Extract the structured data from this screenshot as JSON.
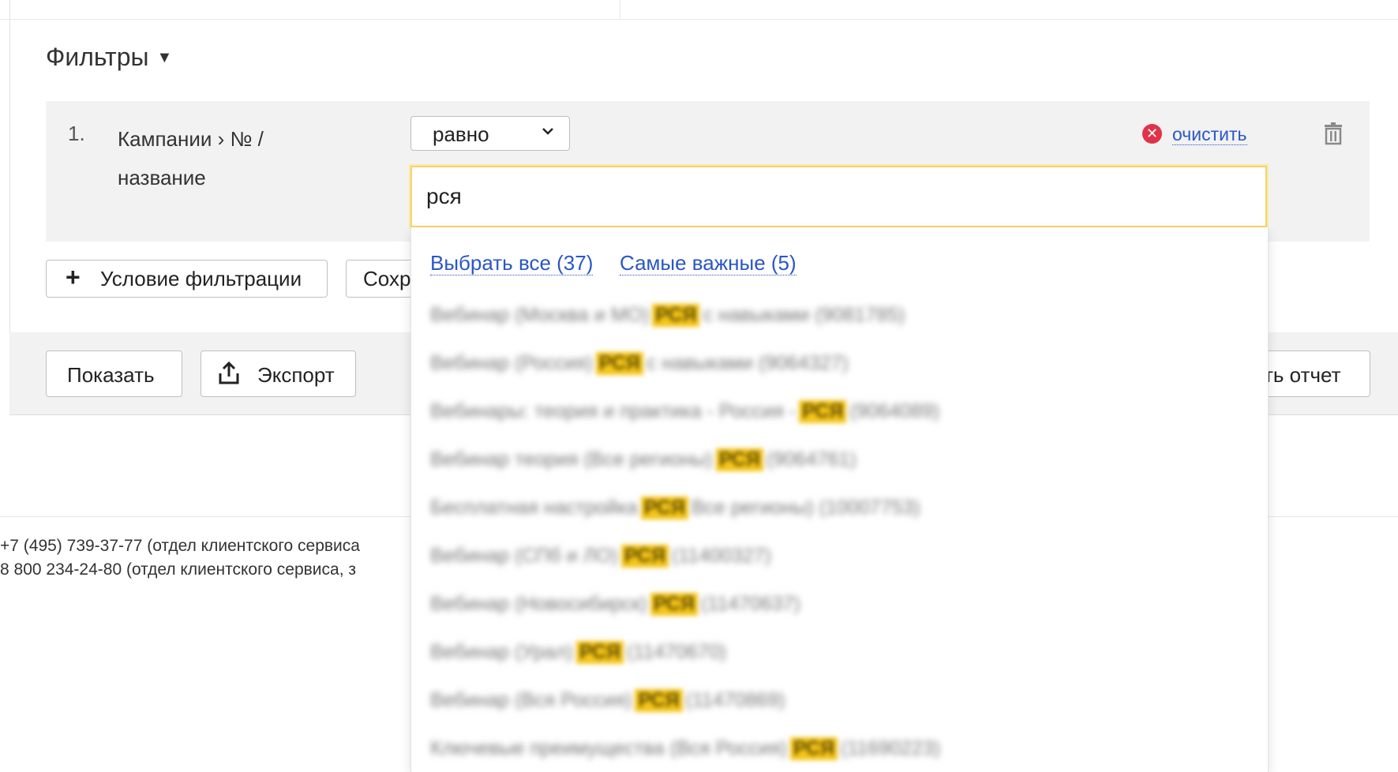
{
  "filters": {
    "title": "Фильтры",
    "toggle_arrow": "▼",
    "row": {
      "index": "1.",
      "field_line1": "Кампании › № /",
      "field_line2": "название",
      "operator": "равно",
      "clear_label": "очистить",
      "search_value": "рся"
    },
    "add_condition_label": "Условие фильтрации",
    "save_label_visible": "Сохр"
  },
  "dropdown": {
    "select_all": "Выбрать все  (37)",
    "most_important": "Самые важные  (5)",
    "items": [
      {
        "before": "Вебинар (Москва и МО)",
        "match": "РСЯ",
        "after": "с навыками (9081785)"
      },
      {
        "before": "Вебинар (Россия)",
        "match": "РСЯ",
        "after": "с навыками (9064327)"
      },
      {
        "before": "Вебинары: теория и практика - Россия -",
        "match": "РСЯ",
        "after": "(9064089)"
      },
      {
        "before": "Вебинар теория (Все регионы)",
        "match": "РСЯ",
        "after": "(9064761)"
      },
      {
        "before": "Бесплатная настройка",
        "match": "РСЯ",
        "after": "Все регионы) (10007753)"
      },
      {
        "before": "Вебинар (СПб и ЛО)",
        "match": "РСЯ",
        "after": "(11400327)"
      },
      {
        "before": "Вебинар (Новосибирск)",
        "match": "РСЯ",
        "after": "(11470637)"
      },
      {
        "before": "Вебинар (Урал)",
        "match": "РСЯ",
        "after": "(11470670)"
      },
      {
        "before": "Вебинар (Вся Россия)",
        "match": "РСЯ",
        "after": "(11470869)"
      },
      {
        "before": "Ключевые преимущества (Вся Россия)",
        "match": "РСЯ",
        "after": "(11690223)"
      }
    ]
  },
  "actions": {
    "show_label": "Показать",
    "export_label": "Экспорт",
    "report_label_visible": "ть отчет"
  },
  "footer": {
    "line1": "+7 (495) 739-37-77 (отдел клиентского сервиса",
    "line2": "8 800 234-24-80 (отдел клиентского сервиса, з"
  },
  "colors": {
    "link": "#2a56c6",
    "highlight": "#f5c518",
    "clear_icon": "#e0334a",
    "input_focus": "#f6d36b"
  },
  "icons": [
    "chevron-down-icon",
    "clear-x-icon",
    "trash-icon",
    "plus-icon",
    "export-icon"
  ]
}
